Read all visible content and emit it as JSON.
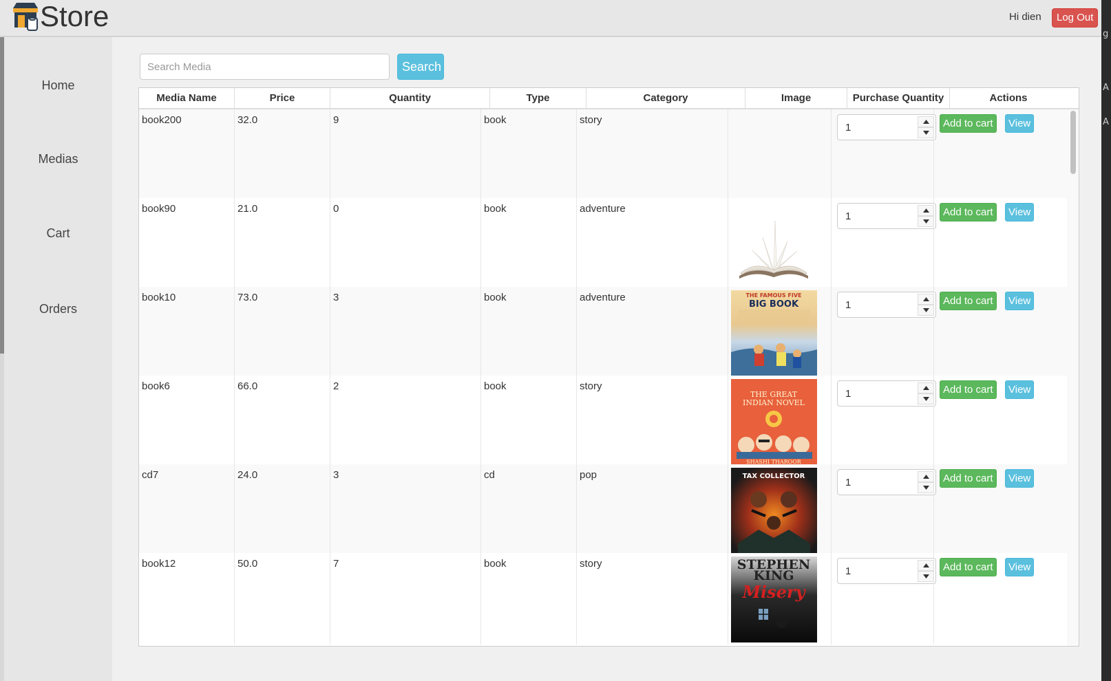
{
  "header": {
    "brand": "Store",
    "greeting": "Hi dien",
    "logout_label": "Log Out"
  },
  "sidebar": {
    "items": [
      {
        "label": "Home"
      },
      {
        "label": "Medias"
      },
      {
        "label": "Cart"
      },
      {
        "label": "Orders"
      }
    ]
  },
  "search": {
    "placeholder": "Search Media",
    "value": "",
    "button_label": "Search"
  },
  "table": {
    "headers": [
      "Media Name",
      "Price",
      "Quantity",
      "Type",
      "Category",
      "Image",
      "Purchase Quantity",
      "Actions"
    ],
    "add_label": "Add to cart",
    "view_label": "View",
    "rows": [
      {
        "name": "book200",
        "price": "32.0",
        "quantity": "9",
        "type": "book",
        "category": "story",
        "image": "none",
        "purchase": "1"
      },
      {
        "name": "book90",
        "price": "21.0",
        "quantity": "0",
        "type": "book",
        "category": "adventure",
        "image": "open-book",
        "purchase": "1"
      },
      {
        "name": "book10",
        "price": "73.0",
        "quantity": "3",
        "type": "book",
        "category": "adventure",
        "image": "famous-five-cover",
        "purchase": "1"
      },
      {
        "name": "book6",
        "price": "66.0",
        "quantity": "2",
        "type": "book",
        "category": "story",
        "image": "great-indian-novel-cover",
        "purchase": "1"
      },
      {
        "name": "cd7",
        "price": "24.0",
        "quantity": "3",
        "type": "cd",
        "category": "pop",
        "image": "tax-collector-cover",
        "purchase": "1"
      },
      {
        "name": "book12",
        "price": "50.0",
        "quantity": "7",
        "type": "book",
        "category": "story",
        "image": "misery-cover",
        "purchase": "1"
      }
    ]
  },
  "covers": {
    "famous_five": {
      "line1": "THE FAMOUS FIVE",
      "line2": "BIG BOOK"
    },
    "great_indian_novel": {
      "line1": "THE GREAT",
      "line2": "INDIAN NOVEL",
      "author": "SHASHI THAROOR"
    },
    "tax_collector": {
      "title": "TAX COLLECTOR"
    },
    "misery": {
      "author1": "STEPHEN",
      "author2": "KING",
      "title": "Misery"
    }
  },
  "colors": {
    "danger": "#d9534f",
    "success": "#5cb85c",
    "info": "#5bc0de",
    "brand_icon": "#f0a830"
  },
  "right_strip_glyphs": [
    "g",
    "A",
    "A"
  ]
}
